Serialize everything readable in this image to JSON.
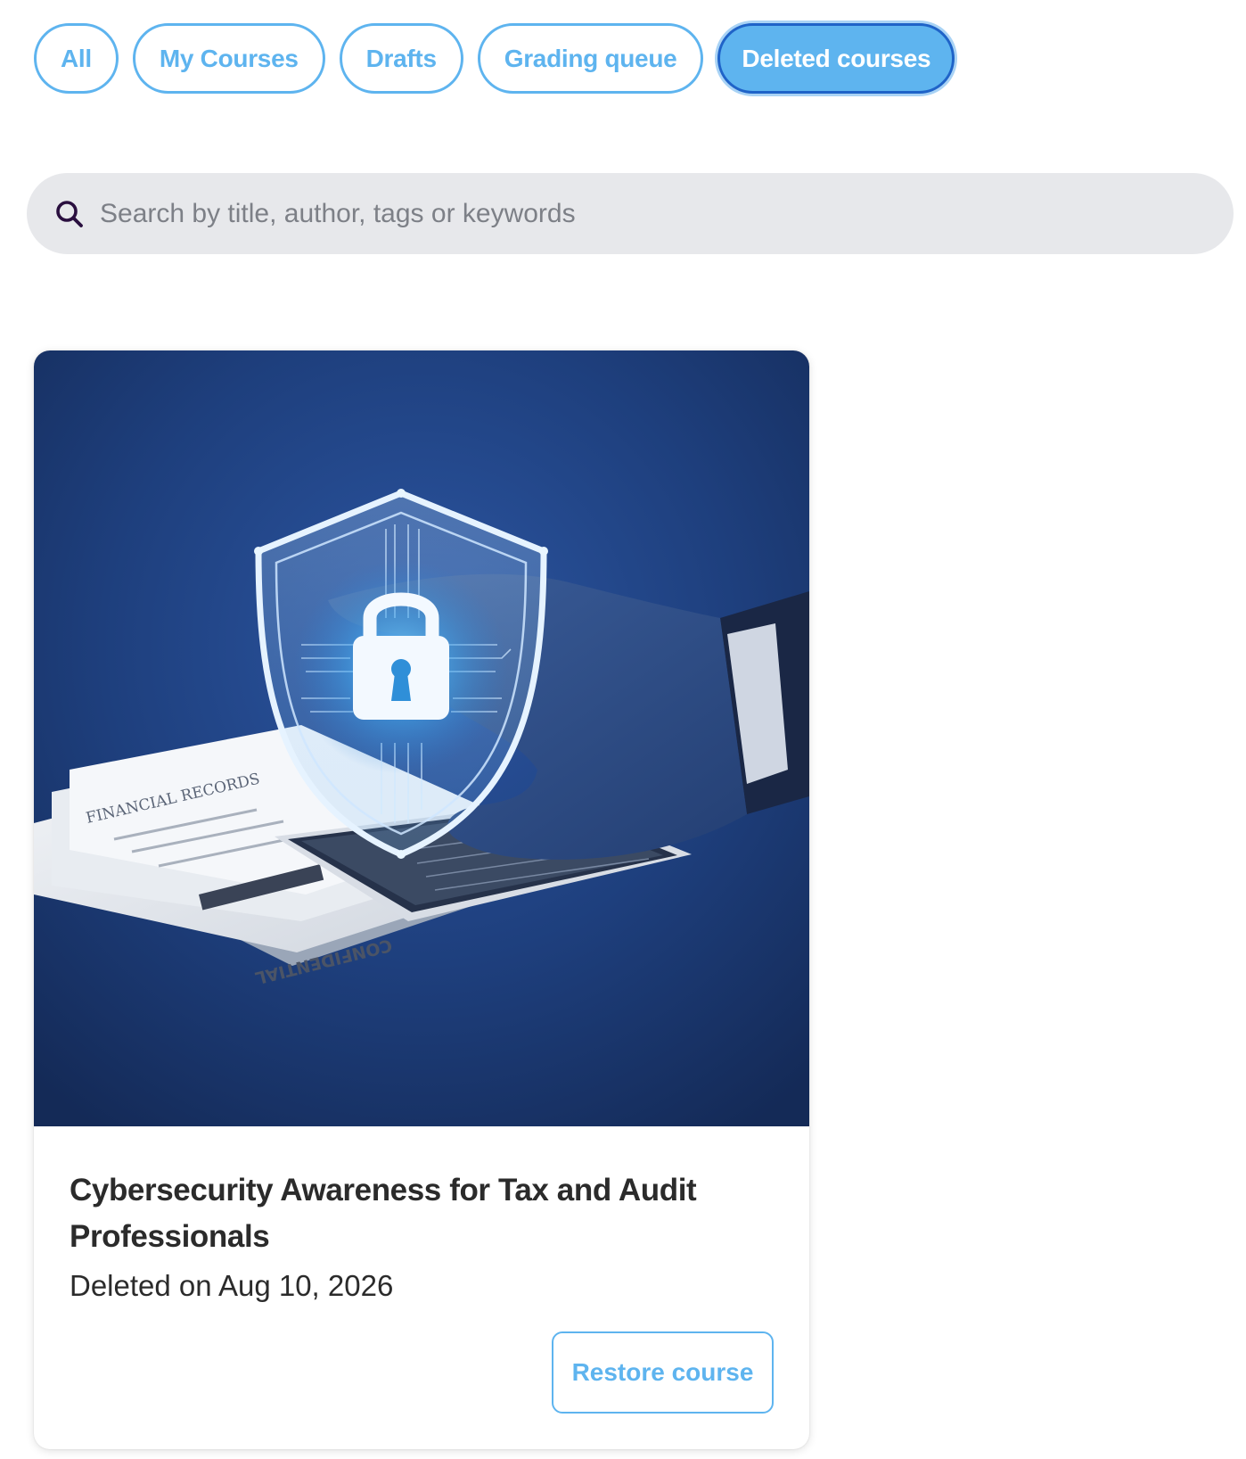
{
  "filters": {
    "tabs": [
      {
        "label": "All",
        "active": false
      },
      {
        "label": "My Courses",
        "active": false
      },
      {
        "label": "Drafts",
        "active": false
      },
      {
        "label": "Grading queue",
        "active": false
      },
      {
        "label": "Deleted courses",
        "active": true
      }
    ]
  },
  "search": {
    "placeholder": "Search by title, author, tags or keywords",
    "icon": "search-icon",
    "value": ""
  },
  "courses": [
    {
      "title": "Cybersecurity Awareness for Tax and Audit Professionals",
      "meta": "Deleted on Aug 10, 2026",
      "action_label": "Restore course",
      "image": {
        "icon": "shield-lock-icon",
        "document_text": "FINANCIAL RECORDS",
        "stamp_text": "CONFIDENTIAL"
      }
    }
  ],
  "colors": {
    "accent": "#5eb4ef",
    "active_border": "#1f63c8",
    "search_bg": "#e7e8eb",
    "text": "#2b2b2b",
    "image_bg": "#1e3f7d"
  }
}
